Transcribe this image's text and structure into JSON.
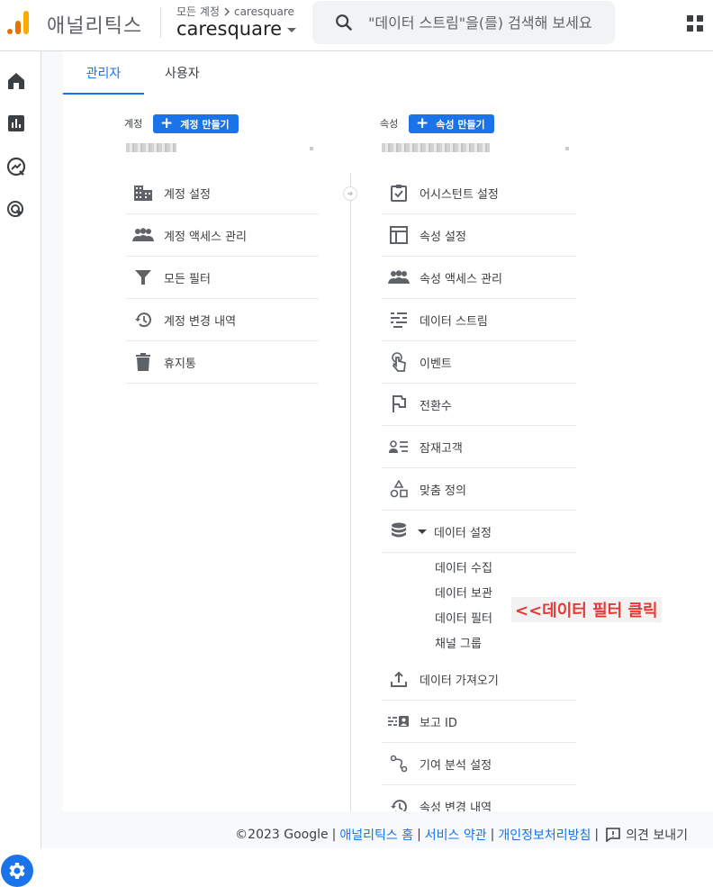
{
  "header": {
    "app_name": "애널리틱스",
    "crumb_all": "모든 계정",
    "crumb_account": "caresquare",
    "account_name": "caresquare",
    "search_placeholder": "\"데이터 스트림\"을(를) 검색해 보세요"
  },
  "tabs": [
    {
      "label": "관리자",
      "active": true
    },
    {
      "label": "사용자",
      "active": false
    }
  ],
  "account_col": {
    "label": "계정",
    "create_label": "계정 만들기",
    "items": [
      {
        "label": "계정 설정",
        "icon": "building-icon"
      },
      {
        "label": "계정 액세스 관리",
        "icon": "people-icon"
      },
      {
        "label": "모든 필터",
        "icon": "filter-icon"
      },
      {
        "label": "계정 변경 내역",
        "icon": "history-icon"
      },
      {
        "label": "휴지통",
        "icon": "trash-icon"
      }
    ]
  },
  "property_col": {
    "label": "속성",
    "create_label": "속성 만들기",
    "items": [
      {
        "label": "어시스턴트 설정",
        "icon": "checklist-icon"
      },
      {
        "label": "속성 설정",
        "icon": "layout-icon"
      },
      {
        "label": "속성 액세스 관리",
        "icon": "people-icon"
      },
      {
        "label": "데이터 스트림",
        "icon": "streams-icon"
      },
      {
        "label": "이벤트",
        "icon": "touch-icon"
      },
      {
        "label": "전환수",
        "icon": "flag-icon"
      },
      {
        "label": "잠재고객",
        "icon": "audience-icon"
      },
      {
        "label": "맞춤 정의",
        "icon": "shapes-icon"
      },
      {
        "label": "데이터 설정",
        "icon": "database-icon"
      }
    ],
    "data_settings_sub": [
      "데이터 수집",
      "데이터 보관",
      "데이터 필터",
      "채널 그룹"
    ],
    "items_after": [
      {
        "label": "데이터 가져오기",
        "icon": "upload-icon"
      },
      {
        "label": "보고 ID",
        "icon": "report-id-icon"
      },
      {
        "label": "기여 분석 설정",
        "icon": "attribution-icon"
      },
      {
        "label": "속성 변경 내역",
        "icon": "history-icon"
      }
    ]
  },
  "annotation": "<<데이터 필터 클릭",
  "footer": {
    "copyright": "©2023 Google",
    "links": [
      "애널리틱스 홈",
      "서비스 약관",
      "개인정보처리방침"
    ],
    "feedback": "의견 보내기"
  },
  "colors": {
    "accent": "#1a73e8",
    "callout": "#e53935",
    "logo_orange": "#f9ab00",
    "logo_dark": "#e37400"
  }
}
